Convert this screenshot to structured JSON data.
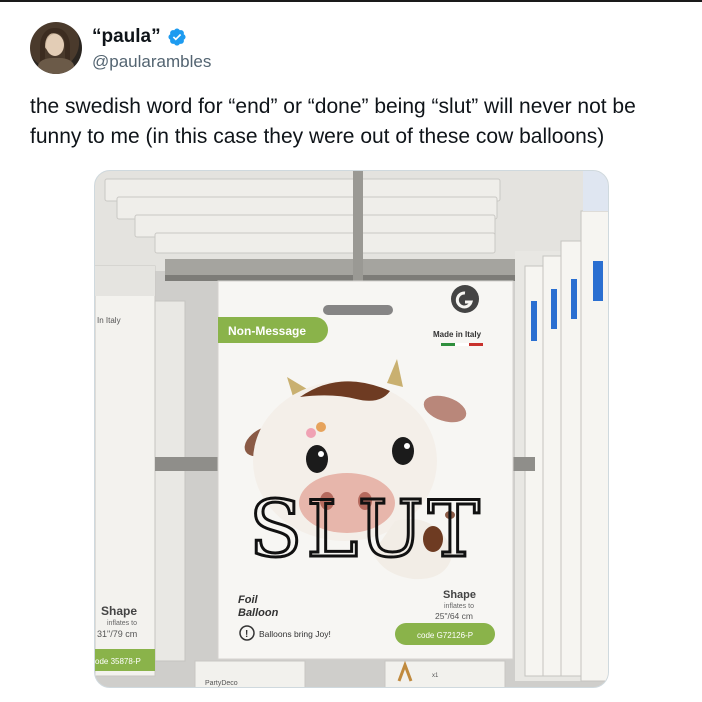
{
  "tweet": {
    "display_name": "“paula”",
    "handle": "@paularambles",
    "text": "the swedish word for “end” or “done” being “slut” will never not be funny to me (in this case they were out of these cow balloons)",
    "verified": true,
    "verified_color": "#1d9bf0"
  },
  "photo": {
    "card_tag": "Non-Message",
    "made_in": "Made in Italy",
    "scrawl": "SLUT",
    "foil_line1": "Foil",
    "foil_line2": "Balloon",
    "joy_text": "Balloons bring Joy!",
    "shape_label": "Shape",
    "inflates_label": "inflates to",
    "size_main": "25\"/64 cm",
    "code_main": "code G72126-P",
    "left_shape": "Shape",
    "left_inflates": "inflates to",
    "left_size": "31\"/79 cm",
    "left_code": "ode 35878-P",
    "left_italy": "In Italy",
    "brand": "PartyDeco",
    "tag_x1": "x1",
    "accent_green": "#8ab34a",
    "card_bg": "#f7f6f3"
  }
}
